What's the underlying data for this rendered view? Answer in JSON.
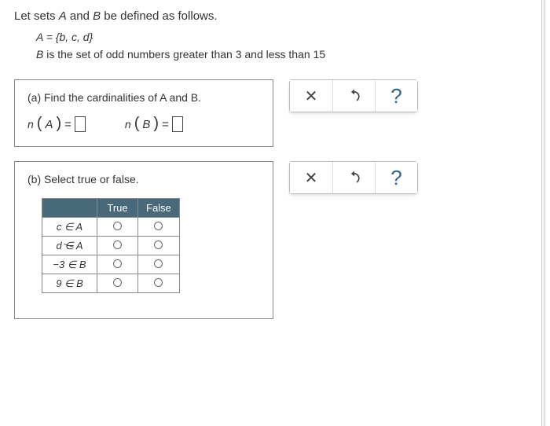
{
  "intro_prefix": "Let sets ",
  "intro_mid": " and ",
  "intro_suffix": " be defined as follows.",
  "setA_symbol": "A",
  "setB_symbol": "B",
  "setA_def": "A = {b, c, d}",
  "setB_desc_prefix": "B",
  "setB_desc": " is the set of odd numbers greater than 3 and less than 15",
  "partA": {
    "prompt": "(a) Find the cardinalities of A and B.",
    "nA_lhs": "n",
    "nA_var": "A",
    "nB_lhs": "n",
    "nB_var": "B",
    "eq": "="
  },
  "partB": {
    "prompt": "(b) Select true or false.",
    "header_true": "True",
    "header_false": "False",
    "rows": [
      {
        "lhs": "c",
        "rel": "∈",
        "rhs": "A"
      },
      {
        "lhs": "d",
        "rel": "notin",
        "rhs": "A"
      },
      {
        "lhs": "−3",
        "rel": "∈",
        "rhs": "B"
      },
      {
        "lhs": "9",
        "rel": "∈",
        "rhs": "B"
      }
    ]
  },
  "toolbar": {
    "close": "✕",
    "help": "?"
  }
}
